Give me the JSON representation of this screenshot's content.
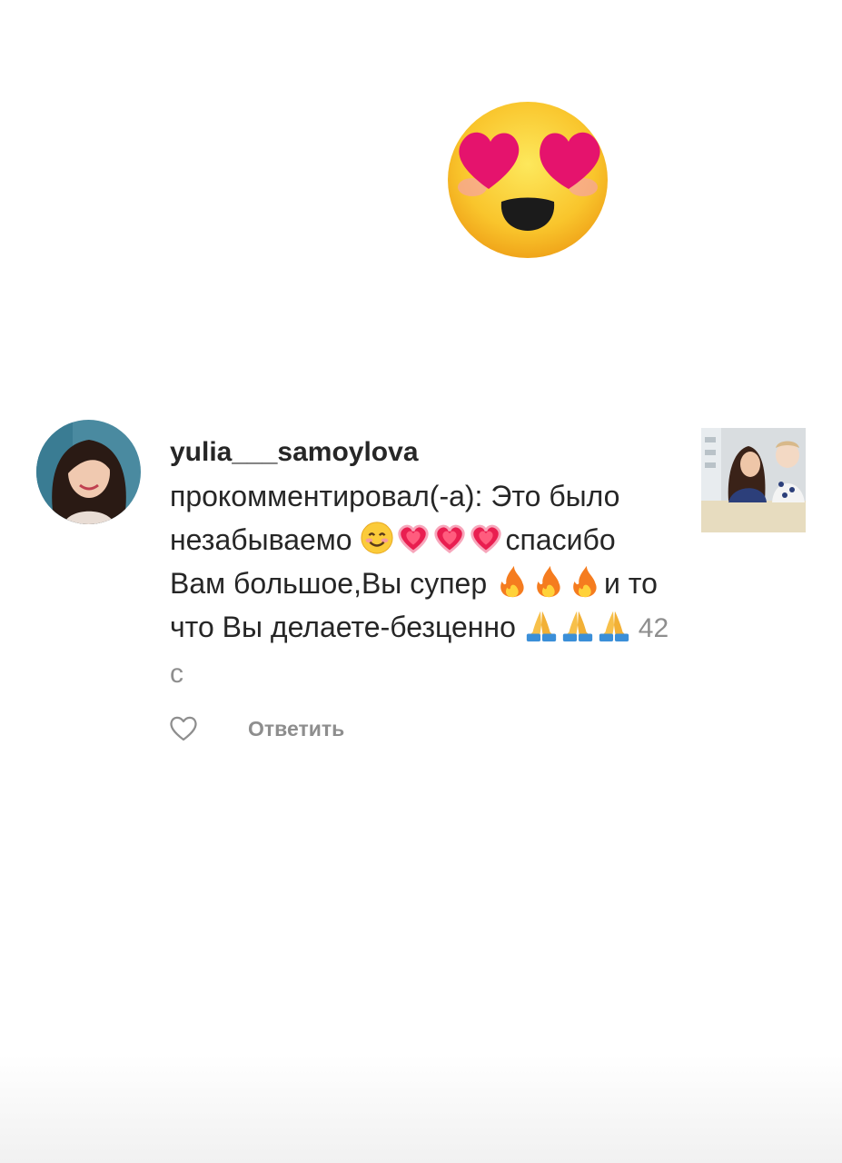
{
  "sticker": {
    "icon": "heart-eyes-emoji-icon"
  },
  "comment": {
    "username": "yulia___samoylova",
    "segments": [
      "прокомментировал(-а): Это было незабываемо ",
      "спасибо Вам большое,Вы супер ",
      "и то что Вы делаете-безценно "
    ],
    "emoji_icons": [
      "smiling-face-icon",
      "sparkling-heart-icon",
      "fire-icon",
      "folded-hands-icon"
    ],
    "timestamp": "42 с"
  },
  "actions": {
    "reply_label": "Ответить"
  },
  "colors": {
    "text": "#262626",
    "secondary": "#8e8e8e",
    "background": "#ffffff"
  }
}
